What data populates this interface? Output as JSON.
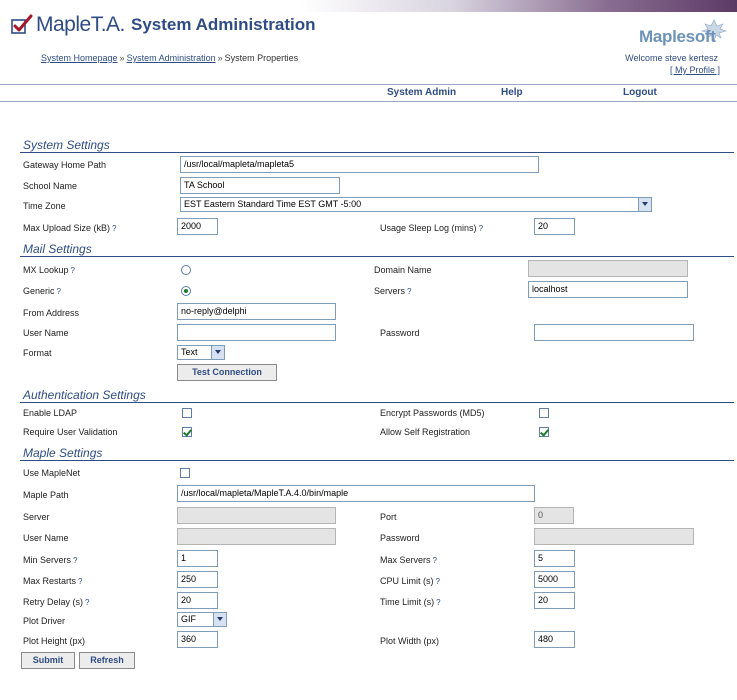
{
  "header": {
    "app_name": "MapleT.A.",
    "page_title": "System Administration",
    "brand": "Maplesoft",
    "welcome": "Welcome steve kertesz",
    "my_profile": "[ My Profile ]"
  },
  "breadcrumb": {
    "items": [
      "System Homepage",
      "System Administration",
      "System Properties"
    ],
    "separator": "»"
  },
  "nav": {
    "items": [
      "System Admin",
      "Help",
      "Logout"
    ]
  },
  "help_mark": "?",
  "system_settings": {
    "title": "System Settings",
    "gateway_home_path": {
      "label": "Gateway Home Path",
      "value": "/usr/local/mapleta/mapleta5"
    },
    "school_name": {
      "label": "School Name",
      "value": "TA School"
    },
    "time_zone": {
      "label": "Time Zone",
      "value": "EST Eastern Standard Time EST GMT -5:00"
    },
    "max_upload_size": {
      "label": "Max Upload Size (kB)",
      "value": "2000"
    },
    "usage_sleep_log": {
      "label": "Usage Sleep Log (mins)",
      "value": "20"
    }
  },
  "mail_settings": {
    "title": "Mail Settings",
    "mx_lookup": {
      "label": "MX Lookup",
      "checked": false
    },
    "generic": {
      "label": "Generic",
      "checked": true
    },
    "domain_name": {
      "label": "Domain Name",
      "value": ""
    },
    "servers": {
      "label": "Servers",
      "value": "localhost"
    },
    "from_address": {
      "label": "From Address",
      "value": "no-reply@delphi"
    },
    "user_name": {
      "label": "User Name",
      "value": ""
    },
    "password": {
      "label": "Password",
      "value": ""
    },
    "format": {
      "label": "Format",
      "value": "Text"
    },
    "test_connection": "Test Connection"
  },
  "auth_settings": {
    "title": "Authentication Settings",
    "enable_ldap": {
      "label": "Enable LDAP",
      "checked": false
    },
    "encrypt_passwords": {
      "label": "Encrypt Passwords (MD5)",
      "checked": false
    },
    "require_user_validation": {
      "label": "Require User Validation",
      "checked": true
    },
    "allow_self_registration": {
      "label": "Allow Self Registration",
      "checked": true
    }
  },
  "maple_settings": {
    "title": "Maple Settings",
    "use_maplenet": {
      "label": "Use MapleNet",
      "checked": false
    },
    "maple_path": {
      "label": "Maple Path",
      "value": "/usr/local/mapleta/MapleT.A.4.0/bin/maple"
    },
    "server": {
      "label": "Server",
      "value": ""
    },
    "port": {
      "label": "Port",
      "value": "0"
    },
    "user_name": {
      "label": "User Name",
      "value": ""
    },
    "password": {
      "label": "Password",
      "value": ""
    },
    "min_servers": {
      "label": "Min Servers",
      "value": "1"
    },
    "max_servers": {
      "label": "Max Servers",
      "value": "5"
    },
    "max_restarts": {
      "label": "Max Restarts",
      "value": "250"
    },
    "cpu_limit": {
      "label": "CPU Limit (s)",
      "value": "5000"
    },
    "retry_delay": {
      "label": "Retry Delay (s)",
      "value": "20"
    },
    "time_limit": {
      "label": "Time Limit (s)",
      "value": "20"
    },
    "plot_driver": {
      "label": "Plot Driver",
      "value": "GIF"
    },
    "plot_height": {
      "label": "Plot Height (px)",
      "value": "360"
    },
    "plot_width": {
      "label": "Plot Width (px)",
      "value": "480"
    }
  },
  "actions": {
    "submit": "Submit",
    "refresh": "Refresh"
  },
  "colors": {
    "brand_blue": "#2f4c84",
    "accent_purple": "#5c3a66",
    "check_green": "#1f7a2a"
  }
}
